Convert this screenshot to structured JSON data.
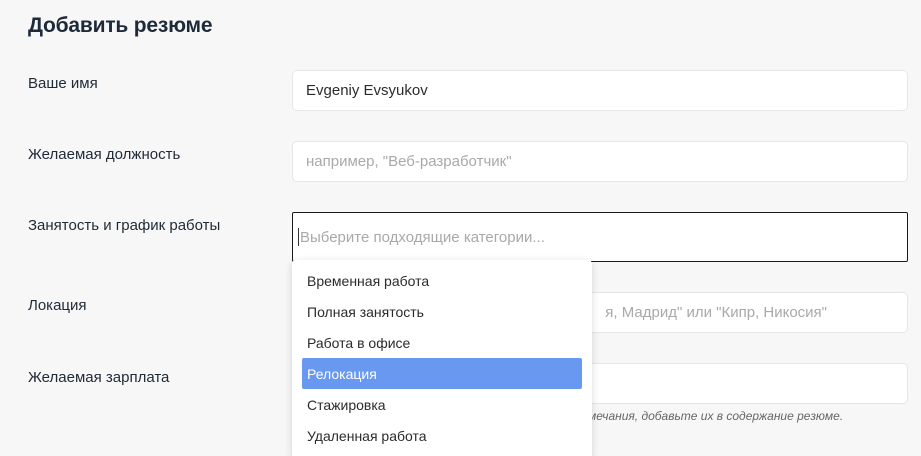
{
  "form": {
    "title": "Добавить резюме",
    "name": {
      "label": "Ваше имя",
      "value": "Evgeniy Evsyukov"
    },
    "position": {
      "label": "Желаемая должность",
      "placeholder": "например, \"Веб-разработчик\""
    },
    "employment": {
      "label": "Занятость и график работы",
      "placeholder": "Выберите подходящие категории..."
    },
    "location": {
      "label": "Локация",
      "placeholder_visible": "я, Мадрид\" или \"Кипр, Никосия\""
    },
    "salary": {
      "label": "Желаемая зарплата",
      "hint_visible": "мечания, добавьте их в содержание резюме."
    }
  },
  "dropdown": {
    "options": [
      {
        "label": "Временная работа",
        "active": false
      },
      {
        "label": "Полная занятость",
        "active": false
      },
      {
        "label": "Работа в офисе",
        "active": false
      },
      {
        "label": "Релокация",
        "active": true
      },
      {
        "label": "Стажировка",
        "active": false
      },
      {
        "label": "Удаленная работа",
        "active": false
      }
    ]
  },
  "colors": {
    "background": "#f7f7f7",
    "highlight": "#6898f0",
    "title": "#1e2a3a"
  }
}
